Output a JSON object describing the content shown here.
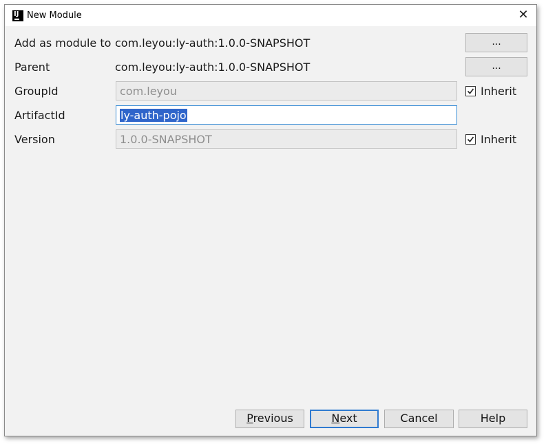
{
  "window": {
    "title": "New Module",
    "app_icon_text": "IJ",
    "close_glyph": "✕"
  },
  "form": {
    "add_as_module_to": {
      "label": "Add as module to",
      "value": "com.leyou:ly-auth:1.0.0-SNAPSHOT",
      "browse_label": "..."
    },
    "parent": {
      "label": "Parent",
      "value": "com.leyou:ly-auth:1.0.0-SNAPSHOT",
      "browse_label": "..."
    },
    "group_id": {
      "label": "GroupId",
      "value": "com.leyou",
      "inherit_label": "Inherit",
      "inherit_checked": true
    },
    "artifact_id": {
      "label": "ArtifactId",
      "value": "ly-auth-pojo"
    },
    "version": {
      "label": "Version",
      "value": "1.0.0-SNAPSHOT",
      "inherit_label": "Inherit",
      "inherit_checked": true
    }
  },
  "buttons": {
    "previous": {
      "mnemonic": "P",
      "rest": "revious"
    },
    "next": {
      "mnemonic": "N",
      "rest": "ext"
    },
    "cancel": "Cancel",
    "help": "Help"
  },
  "colors": {
    "selection": "#2f65ca",
    "focus_border": "#3c8fd6",
    "default_button_border": "#2f7ad0"
  },
  "icons": {
    "close": "close-icon",
    "app": "intellij-icon",
    "check": "checkmark-icon"
  }
}
